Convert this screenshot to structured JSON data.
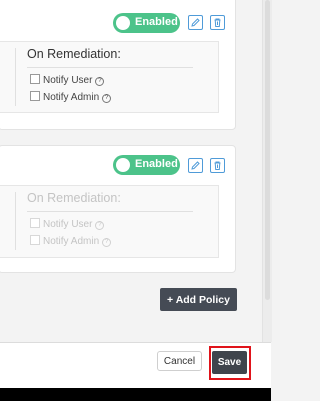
{
  "policies": [
    {
      "status_label": "Enabled",
      "remediation_heading": "On Remediation:",
      "options": [
        {
          "label": "Notify User",
          "checked": false
        },
        {
          "label": "Notify Admin",
          "checked": false
        }
      ],
      "disabled_section": false
    },
    {
      "status_label": "Enabled",
      "remediation_heading": "On Remediation:",
      "options": [
        {
          "label": "Notify User",
          "checked": false
        },
        {
          "label": "Notify Admin",
          "checked": false
        }
      ],
      "disabled_section": true
    }
  ],
  "actions": {
    "add_policy_label": "+ Add Policy"
  },
  "footer": {
    "cancel_label": "Cancel",
    "save_label": "Save"
  },
  "icons": {
    "help": "?",
    "edit": "pencil-icon",
    "delete": "trash-icon"
  },
  "colors": {
    "enabled_toggle": "#4cc38a",
    "action_button": "#454b55",
    "icon_blue": "#4f9bd8",
    "highlight_red": "#e0131a"
  }
}
